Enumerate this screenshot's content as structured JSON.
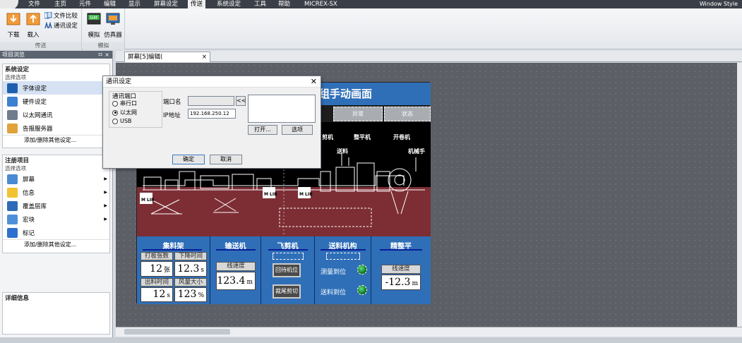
{
  "menu": {
    "items": [
      "文件",
      "主页",
      "元件",
      "编辑",
      "显示",
      "屏幕设定",
      "传送",
      "系统设定",
      "工具",
      "帮助",
      "MICREX-SX"
    ],
    "active_index": 6,
    "window_style": "Window Style"
  },
  "ribbon": {
    "download": "下载",
    "upload": "载入",
    "file_compare": "文件比较",
    "comm_settings": "通讯设定",
    "transfer_group": "传送",
    "simulate": "模拟",
    "simulator": "仿真器",
    "simulate_group": "模拟"
  },
  "left_panel": {
    "header": "项目浏览",
    "pin": "ㅁ ×",
    "system_settings": {
      "title": "系统设定",
      "subtitle": "选择选项",
      "items": [
        "字体设定",
        "硬件设定",
        "以太网通讯",
        "告报服务器"
      ],
      "add_link": "添加/删除其他设定..."
    },
    "registered_items": {
      "title": "注册项目",
      "subtitle": "选择选项",
      "items": [
        "屏幕",
        "信息",
        "覆盖层库",
        "宏块",
        "标记"
      ],
      "add_link": "添加/删除其他设定..."
    },
    "details": {
      "title": "详细信息"
    }
  },
  "editor": {
    "tab_label": "屏幕[5]编辑(",
    "tab_close": "×"
  },
  "hmi": {
    "title": "组手动画面",
    "buttons": [
      "异常",
      "状态"
    ],
    "machine_labels": [
      "剪机",
      "整平机",
      "开卷机",
      "送料",
      "机械手"
    ],
    "columns": [
      {
        "title": "集料架"
      },
      {
        "title": "输送机"
      },
      {
        "title": "飞剪机"
      },
      {
        "title": "送料机构"
      },
      {
        "title": "精整平"
      }
    ],
    "stack": {
      "label1": "打板张数",
      "value1": "12",
      "unit1": "张",
      "label2": "下降时间",
      "value2": "12.3",
      "unit2": "s",
      "label3": "出料时间",
      "value3": "12",
      "unit3": "s",
      "label4": "风量大小",
      "value4": "123",
      "unit4": "%"
    },
    "conveyor": {
      "label": "线速度",
      "value": "123.4",
      "unit": "m"
    },
    "shear": {
      "btn1": "回待机位",
      "btn2": "裁尾剪切"
    },
    "feed": {
      "measure": "测量到位",
      "feed": "送料到位"
    },
    "leveler": {
      "label": "线速度",
      "value": "-12.3",
      "unit": "m"
    }
  },
  "dialog": {
    "title": "通讯设定",
    "close": "✕",
    "port_group": "通讯端口",
    "options": [
      "串行口",
      "以太网",
      "USB"
    ],
    "selected": 1,
    "port_name_label": "端口名",
    "ip_label": "IP地址",
    "ip_value": "192.168.250.12",
    "browse": "<<",
    "open_btn": "打开...",
    "options_btn": "选项",
    "ok": "确定",
    "cancel": "取消"
  }
}
